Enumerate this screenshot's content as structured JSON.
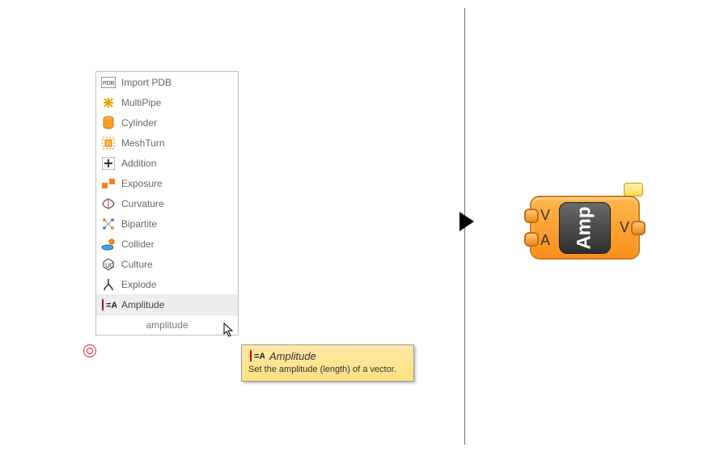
{
  "menu": {
    "items": [
      {
        "label": "Import PDB",
        "icon": "pdb-icon"
      },
      {
        "label": "MultiPipe",
        "icon": "multipipe-icon"
      },
      {
        "label": "Cylinder",
        "icon": "cylinder-icon"
      },
      {
        "label": "MeshTurn",
        "icon": "meshturn-icon"
      },
      {
        "label": "Addition",
        "icon": "plus-icon"
      },
      {
        "label": "Exposure",
        "icon": "exposure-icon"
      },
      {
        "label": "Curvature",
        "icon": "curvature-icon"
      },
      {
        "label": "Bipartite",
        "icon": "bipartite-icon"
      },
      {
        "label": "Collider",
        "icon": "collider-icon"
      },
      {
        "label": "Culture",
        "icon": "culture-icon"
      },
      {
        "label": "Explode",
        "icon": "explode-icon"
      },
      {
        "label": "Amplitude",
        "icon": "amplitude-icon"
      }
    ],
    "highlighted_index": 11,
    "search": "amplitude"
  },
  "tooltip": {
    "title": "Amplitude",
    "desc": "Set the amplitude (length) of a vector."
  },
  "component": {
    "name": "Amp",
    "inputs": [
      "V",
      "A"
    ],
    "outputs": [
      "V"
    ]
  }
}
